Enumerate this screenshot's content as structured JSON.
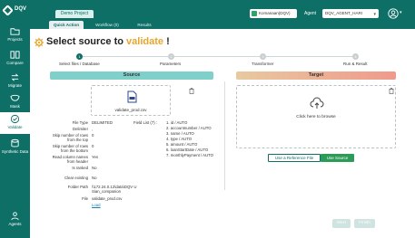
{
  "app": {
    "logo_text": "DQV"
  },
  "sidebar": {
    "items": [
      {
        "label": "Projects",
        "icon": "folder-icon"
      },
      {
        "label": "Compare",
        "icon": "compare-icon"
      },
      {
        "label": "Migrate",
        "icon": "migrate-icon"
      },
      {
        "label": "Mask",
        "icon": "mask-icon"
      },
      {
        "label": "Validate",
        "icon": "validate-icon",
        "active": true
      },
      {
        "label": "Synthetic Data",
        "icon": "synthetic-data-icon"
      },
      {
        "label": "Agents",
        "icon": "agents-icon"
      }
    ]
  },
  "header": {
    "project_tab": "Demo Project",
    "sub_tabs": [
      {
        "label": "Quick Action",
        "active": true
      },
      {
        "label": "Workflow (0)",
        "active": false
      },
      {
        "label": "Results",
        "active": false
      }
    ],
    "chip_label": "Komanaan(DQV)",
    "agent_label": "Agent",
    "agent_value": "DQV_AGENT_HARI"
  },
  "main": {
    "title_prefix": "Select source to",
    "title_highlight": "validate",
    "title_suffix": "!",
    "steps": [
      {
        "label": "Select files / Database",
        "active": true
      },
      {
        "label": "Parameters",
        "active": false
      },
      {
        "label": "Transformer",
        "active": false
      },
      {
        "label": "Run & Result",
        "active": false
      }
    ],
    "source": {
      "header": "Source",
      "file_name": "validate_prod.csv",
      "properties": [
        {
          "key": "File Type",
          "value": "DELIMITED"
        },
        {
          "key": "Delimiter",
          "value": ","
        },
        {
          "key": "Skip number of rows from the top",
          "value": "0"
        },
        {
          "key": "Skip number of rows from the bottom",
          "value": "0"
        },
        {
          "key": "Read column names from header",
          "value": "Yes"
        },
        {
          "key": "Is ranked",
          "value": "No"
        },
        {
          "key": "Clear existing",
          "value": "No"
        },
        {
          "key": "Folder Path",
          "value": "\\\\172.24.0.12\\data\\DQV U Sian_companion"
        },
        {
          "key": "File",
          "value": "validate_prod.csv"
        },
        {
          "key": "",
          "value": "Load",
          "link": true
        }
      ],
      "field_list_label": "Field List (7) :",
      "fields": [
        "1. id / AUTO",
        "2. accountnumber / AUTO",
        "3. name / AUTO",
        "4. type / AUTO",
        "5. amount / AUTO",
        "6. loanStartDate / AUTO",
        "7. monthlyPayment / AUTO"
      ]
    },
    "target": {
      "header": "Target",
      "browse_text": "Click here to browse",
      "btn_reference": "Use a Reference File",
      "btn_source": "Use Source"
    }
  },
  "footer": {
    "next": "Next",
    "finish": "Finish"
  },
  "colors": {
    "brand": "#0e6f67",
    "accent": "#e9a52a",
    "success": "#2d9b58"
  }
}
